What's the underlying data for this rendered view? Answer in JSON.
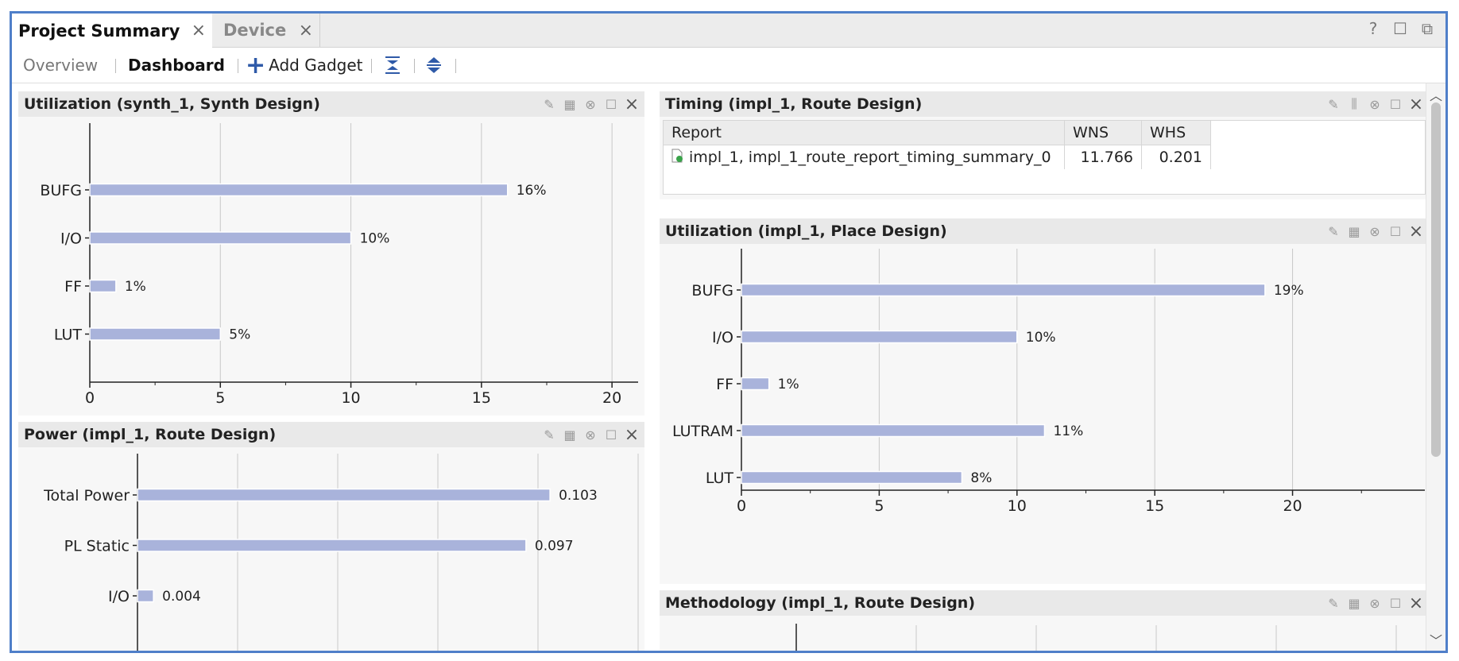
{
  "tabs": [
    {
      "label": "Project Summary",
      "active": true
    },
    {
      "label": "Device",
      "active": false
    }
  ],
  "window_icons": [
    "?",
    "☐",
    "⧉"
  ],
  "toolbar": {
    "overview": "Overview",
    "dashboard": "Dashboard",
    "add_gadget": "Add Gadget",
    "add_icon": "+"
  },
  "panels": {
    "util_synth": {
      "title": "Utilization (synth_1, Synth Design)",
      "chart_data": {
        "type": "bar",
        "orientation": "horizontal",
        "categories": [
          "BUFG",
          "I/O",
          "FF",
          "LUT"
        ],
        "values": [
          16,
          10,
          1,
          5
        ],
        "labels": [
          "16%",
          "10%",
          "1%",
          "5%"
        ],
        "xlim": [
          0,
          21
        ],
        "xticks": [
          0,
          5,
          10,
          15,
          20
        ],
        "grid": true,
        "bar_color": "#a9b3db"
      }
    },
    "power": {
      "title": "Power (impl_1, Route Design)",
      "chart_data": {
        "type": "bar",
        "orientation": "horizontal",
        "categories": [
          "Total Power",
          "PL Static",
          "I/O"
        ],
        "values": [
          0.103,
          0.097,
          0.004
        ],
        "labels": [
          "0.103",
          "0.097",
          "0.004"
        ],
        "xlim": [
          0,
          0.125
        ],
        "gridlines": [
          0.025,
          0.05,
          0.075,
          0.1,
          0.125
        ],
        "grid": true,
        "bar_color": "#a9b3db"
      }
    },
    "timing": {
      "title": "Timing (impl_1, Route Design)",
      "headers": [
        "Report",
        "WNS",
        "WHS"
      ],
      "rows": [
        {
          "report": "impl_1, impl_1_route_report_timing_summary_0",
          "wns": "11.766",
          "whs": "0.201"
        }
      ]
    },
    "util_impl": {
      "title": "Utilization (impl_1, Place Design)",
      "chart_data": {
        "type": "bar",
        "orientation": "horizontal",
        "categories": [
          "BUFG",
          "I/O",
          "FF",
          "LUTRAM",
          "LUT"
        ],
        "values": [
          19,
          10,
          1,
          11,
          8
        ],
        "labels": [
          "19%",
          "10%",
          "1%",
          "11%",
          "8%"
        ],
        "xlim": [
          0,
          24.8
        ],
        "xticks": [
          0,
          5,
          10,
          15,
          20
        ],
        "grid": true,
        "bar_color": "#a9b3db"
      }
    },
    "methodology": {
      "title": "Methodology (impl_1, Route Design)"
    }
  },
  "colors": {
    "frame_border": "#4f7fc9",
    "bar": "#a9b3db",
    "panel_bg": "#f7f7f7",
    "header_bg": "#e9e9e9"
  }
}
